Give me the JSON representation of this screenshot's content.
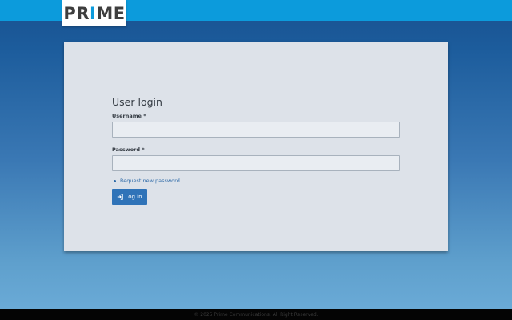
{
  "brand": {
    "logo_left": "PR",
    "logo_bar": "I",
    "logo_right": "ME",
    "accent_color": "#0c9bdc"
  },
  "login": {
    "title": "User login",
    "username_label": "Username *",
    "password_label": "Password *",
    "username_value": "",
    "password_value": "",
    "request_password_link": "Request new password",
    "submit_label": "Log in",
    "submit_icon": "sign-in-icon",
    "button_color": "#2f73b8"
  },
  "footer": {
    "text": "©  2025 Prime Communications. All Right Reserved."
  }
}
